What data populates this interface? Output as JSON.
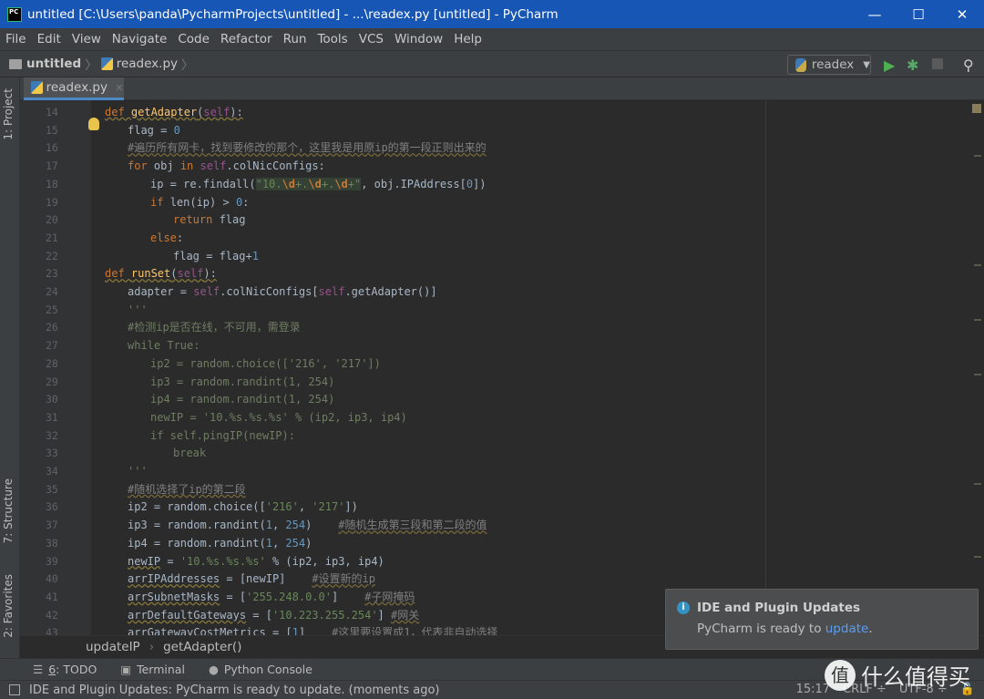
{
  "window": {
    "title": "untitled [C:\\Users\\panda\\PycharmProjects\\untitled] - ...\\readex.py [untitled] - PyCharm",
    "minimize": "—",
    "maximize": "☐",
    "close": "✕",
    "logo": "PC"
  },
  "menu": [
    "File",
    "Edit",
    "View",
    "Navigate",
    "Code",
    "Refactor",
    "Run",
    "Tools",
    "VCS",
    "Window",
    "Help"
  ],
  "nav": {
    "project": "untitled",
    "file": "readex.py",
    "run_config": "readex"
  },
  "tab": {
    "label": "readex.py",
    "close": "×"
  },
  "tool_stripe": {
    "project": "1: Project",
    "structure": "7: Structure",
    "favorites": "2: Favorites"
  },
  "code": [
    {
      "n": "14",
      "indent": 0,
      "fold": true,
      "t": [
        [
          "kw warn",
          "def "
        ],
        [
          "fn warn",
          "getAdapter"
        ],
        [
          "warn",
          "("
        ],
        [
          "self warn",
          "self"
        ],
        [
          "warn",
          "):"
        ]
      ]
    },
    {
      "n": "15",
      "indent": 1,
      "t": [
        [
          "",
          "flag = "
        ],
        [
          "num",
          "0"
        ]
      ]
    },
    {
      "n": "16",
      "indent": 1,
      "t": [
        [
          "cm",
          "#遍历所有网卡，找到要修改的那个，这里我是用原ip的第一段正则出来的"
        ]
      ]
    },
    {
      "n": "17",
      "indent": 1,
      "fold": true,
      "t": [
        [
          "kw",
          "for "
        ],
        [
          "",
          "obj "
        ],
        [
          "kw",
          "in "
        ],
        [
          "self",
          "self"
        ],
        [
          "",
          ".colNicConfigs:"
        ]
      ]
    },
    {
      "n": "18",
      "indent": 2,
      "t": [
        [
          "",
          "ip = re.findall("
        ],
        [
          "strhl",
          "\"10."
        ],
        [
          "esc",
          "\\d"
        ],
        [
          "strhl",
          "+."
        ],
        [
          "esc",
          "\\d"
        ],
        [
          "strhl",
          "+."
        ],
        [
          "esc",
          "\\d"
        ],
        [
          "strhl",
          "+\""
        ],
        [
          "",
          ", obj.IPAddress["
        ],
        [
          "num",
          "0"
        ],
        [
          "",
          "])"
        ]
      ]
    },
    {
      "n": "19",
      "indent": 2,
      "t": [
        [
          "kw",
          "if "
        ],
        [
          "",
          "len(ip) > "
        ],
        [
          "num",
          "0"
        ],
        [
          "",
          ":"
        ]
      ]
    },
    {
      "n": "20",
      "indent": 3,
      "t": [
        [
          "kw",
          "return "
        ],
        [
          "",
          "flag"
        ]
      ]
    },
    {
      "n": "21",
      "indent": 2,
      "t": [
        [
          "kw",
          "else"
        ],
        [
          "",
          ":"
        ]
      ]
    },
    {
      "n": "22",
      "indent": 3,
      "fold": true,
      "t": [
        [
          "",
          "flag = flag+"
        ],
        [
          "num",
          "1"
        ]
      ]
    },
    {
      "n": "23",
      "indent": 0,
      "fold": true,
      "t": [
        [
          "kw warn",
          "def "
        ],
        [
          "fn warn",
          "runSet"
        ],
        [
          "warn",
          "("
        ],
        [
          "self warn",
          "self"
        ],
        [
          "warn",
          "):"
        ]
      ]
    },
    {
      "n": "24",
      "indent": 1,
      "t": [
        [
          "",
          "adapter = "
        ],
        [
          "self",
          "self"
        ],
        [
          "",
          ".colNicConfigs["
        ],
        [
          "self",
          "self"
        ],
        [
          "",
          ".getAdapter()]"
        ]
      ]
    },
    {
      "n": "25",
      "indent": 1,
      "fold": true,
      "t": [
        [
          "doc",
          "'''"
        ]
      ]
    },
    {
      "n": "26",
      "indent": 1,
      "t": [
        [
          "doc",
          "#检测ip是否在线，不可用，需登录"
        ]
      ]
    },
    {
      "n": "27",
      "indent": 1,
      "t": [
        [
          "doc",
          "while True:"
        ]
      ]
    },
    {
      "n": "28",
      "indent": 2,
      "t": [
        [
          "doc",
          "ip2 = random.choice(['216', '217'])"
        ]
      ]
    },
    {
      "n": "29",
      "indent": 2,
      "t": [
        [
          "doc",
          "ip3 = random.randint(1, 254)"
        ]
      ]
    },
    {
      "n": "30",
      "indent": 2,
      "t": [
        [
          "doc",
          "ip4 = random.randint(1, 254)"
        ]
      ]
    },
    {
      "n": "31",
      "indent": 2,
      "t": [
        [
          "doc",
          "newIP = '10.%s.%s.%s' % (ip2, ip3, ip4)"
        ]
      ]
    },
    {
      "n": "32",
      "indent": 2,
      "t": [
        [
          "doc",
          "if self.pingIP(newIP):"
        ]
      ]
    },
    {
      "n": "33",
      "indent": 3,
      "t": [
        [
          "doc",
          "break"
        ]
      ]
    },
    {
      "n": "34",
      "indent": 1,
      "fold": true,
      "t": [
        [
          "doc",
          "'''"
        ]
      ]
    },
    {
      "n": "35",
      "indent": 1,
      "t": [
        [
          "cm",
          "#随机选择了ip的第二段"
        ]
      ]
    },
    {
      "n": "36",
      "indent": 1,
      "t": [
        [
          "",
          "ip2 = random.choice(["
        ],
        [
          "str",
          "'216'"
        ],
        [
          "",
          ", "
        ],
        [
          "str",
          "'217'"
        ],
        [
          "",
          "])"
        ]
      ]
    },
    {
      "n": "37",
      "indent": 1,
      "t": [
        [
          "",
          "ip3 = random.randint("
        ],
        [
          "num",
          "1"
        ],
        [
          "",
          ", "
        ],
        [
          "num",
          "254"
        ],
        [
          "",
          ")    "
        ],
        [
          "cm",
          "#随机生成第三段和第二段的值"
        ]
      ]
    },
    {
      "n": "38",
      "indent": 1,
      "t": [
        [
          "",
          "ip4 = random.randint("
        ],
        [
          "num",
          "1"
        ],
        [
          "",
          ", "
        ],
        [
          "num",
          "254"
        ],
        [
          "",
          ")"
        ]
      ]
    },
    {
      "n": "39",
      "indent": 1,
      "t": [
        [
          "warn",
          "newIP"
        ],
        [
          "",
          " = "
        ],
        [
          "str",
          "'10.%s.%s.%s'"
        ],
        [
          "",
          " % (ip2, ip3, ip4)"
        ]
      ]
    },
    {
      "n": "40",
      "indent": 1,
      "t": [
        [
          "warn",
          "arrIPAddresses"
        ],
        [
          "",
          " = [newIP]    "
        ],
        [
          "cm",
          "#设置新的ip"
        ]
      ]
    },
    {
      "n": "41",
      "indent": 1,
      "t": [
        [
          "warn",
          "arrSubnetMasks"
        ],
        [
          "",
          " = ["
        ],
        [
          "str",
          "'255.248.0.0'"
        ],
        [
          "",
          "]    "
        ],
        [
          "cm",
          "#子网掩码"
        ]
      ]
    },
    {
      "n": "42",
      "indent": 1,
      "t": [
        [
          "warn",
          "arrDefaultGateways"
        ],
        [
          "",
          " = ["
        ],
        [
          "str",
          "'10.223.255.254'"
        ],
        [
          "",
          "] "
        ],
        [
          "cm",
          "#网关"
        ]
      ]
    },
    {
      "n": "43",
      "indent": 1,
      "t": [
        [
          "warn",
          "arrGatewayCostMetrics"
        ],
        [
          "",
          " = ["
        ],
        [
          "num",
          "1"
        ],
        [
          "",
          "]    "
        ],
        [
          "cm",
          "#这里要设置成1，代表非自动选择"
        ]
      ]
    }
  ],
  "breadcrumbs": {
    "class": "updateIP",
    "method": "getAdapter()",
    "sep": "›"
  },
  "tool_windows": [
    {
      "key": "6",
      "label": ": TODO",
      "icon": "☰"
    },
    {
      "label": "Terminal",
      "icon": "▣"
    },
    {
      "label": "Python Console",
      "icon": "●"
    }
  ],
  "status": {
    "message": "IDE and Plugin Updates: PyCharm is ready to update. (moments ago)",
    "position": "15:17",
    "line_sep": "CRLF ÷",
    "encoding": "UTF-8 ÷"
  },
  "notification": {
    "title": "IDE and Plugin Updates",
    "body": "PyCharm is ready to ",
    "link": "update",
    "end": "."
  },
  "watermark": {
    "logo": "值",
    "text": "什么值得买"
  }
}
